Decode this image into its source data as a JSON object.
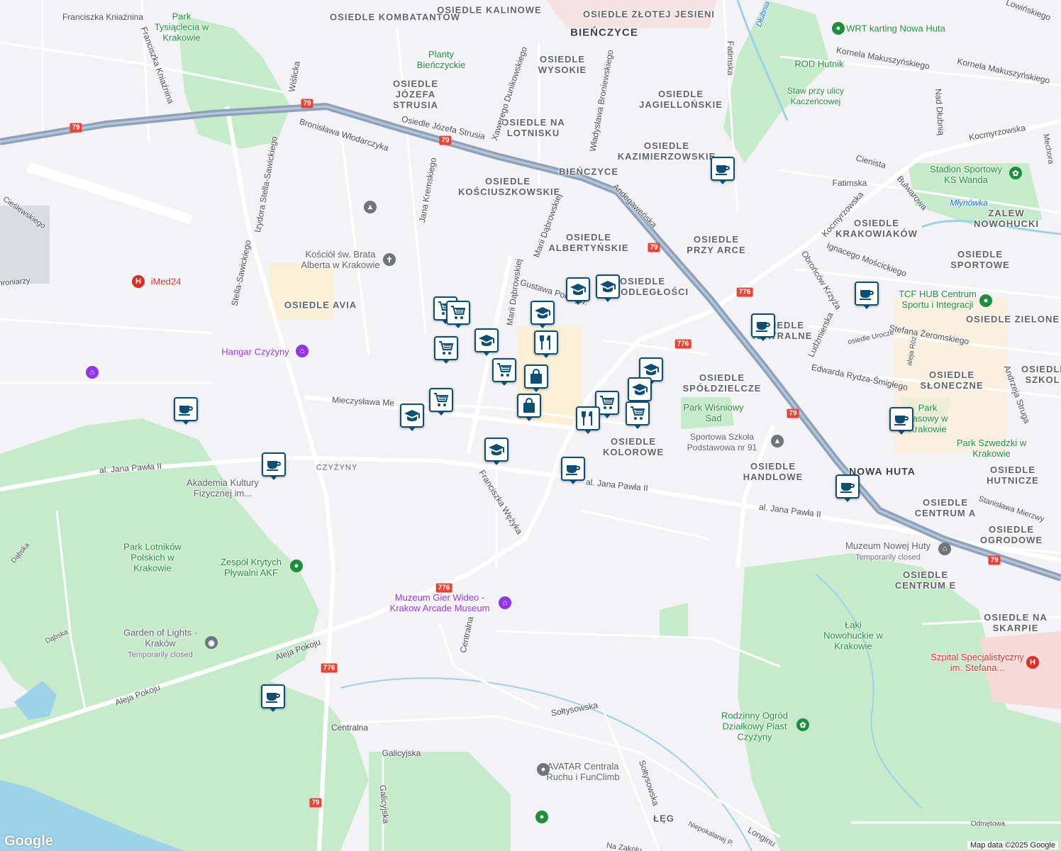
{
  "map": {
    "districts": [
      [
        "OSIEDLE KOMBATANTÓW",
        "osiedle-kombatantow"
      ],
      [
        "OSIEDLE KALINOWE",
        "osiedle-kalinowe"
      ],
      [
        "OSIEDLE ZŁOTEJ JESIENI",
        "osiedle-zlotej-jesieni"
      ],
      [
        "BIEŃCZYCE",
        "bienczyce"
      ],
      [
        "OSIEDLE WYSOKIE",
        "osiedle-wysokie"
      ],
      [
        "OSIEDLE JÓZEFA STRUSIA",
        "osiedle-jozefa-strusia"
      ],
      [
        "OSIEDLE NA LOTNISKU",
        "osiedle-na-lotnisku"
      ],
      [
        "OSIEDLE JAGIELLOŃSKIE",
        "osiedle-jagiellonskie"
      ],
      [
        "OSIEDLE KAZIMIERZOWSKIE",
        "osiedle-kazimierzowskie"
      ],
      [
        "BIEŃCZYCE",
        "bienczyce-2"
      ],
      [
        "OSIEDLE KOŚCIUSZKOWSKIE",
        "osiedle-kosciuszkowskie"
      ],
      [
        "OSIEDLE ALBERTYŃSKIE",
        "osiedle-albertynskie"
      ],
      [
        "OSIEDLE PRZY ARCE",
        "osiedle-przy-arce"
      ],
      [
        "OSIEDLE AVIA",
        "osiedle-avia"
      ],
      [
        "OSIEDLE KRAKOWIAKÓW",
        "osiedle-krakowiakow"
      ],
      [
        "OSIEDLE SPORTOWE",
        "osiedle-sportowe"
      ],
      [
        "OSIEDLE ZIELONE",
        "osiedle-zielone"
      ],
      [
        "OSIEDLE SPÓŁDZIELCZE",
        "osiedle-spoldzielcze"
      ],
      [
        "OSIEDLE SŁONECZNE",
        "osiedle-sloneczne"
      ],
      [
        "OSIEDLE KOLOROWE",
        "osiedle-kolorowe"
      ],
      [
        "OSIEDLE HANDLOWE",
        "osiedle-handlowe"
      ],
      [
        "NOWA HUTA",
        "nowa-huta"
      ],
      [
        "OSIEDLE HUTNICZE",
        "osiedle-hutnicze"
      ],
      [
        "OSIEDLE CENTRUM A",
        "osiedle-centrum-a"
      ],
      [
        "OSIEDLE OGRODOWE",
        "osiedle-ogrodowe"
      ],
      [
        "OSIEDLE CENTRUM E",
        "osiedle-centrum-e"
      ],
      [
        "OSIEDLE NA SKARPIE",
        "osiedle-na-skarpie"
      ],
      [
        "CZYŻYNY",
        "czyzyny"
      ],
      [
        "ŁĘG",
        "leg"
      ],
      [
        "ZALEW NOWOHUCKI",
        "zalew-nowohucki"
      ],
      [
        "OSIEDLE SZKOL",
        "osiedle-szkol"
      ],
      [
        "OSIEDLE TEATRALNE",
        "osiedle-teatralne"
      ],
      [
        "OSIEDLE NIEPODLEGŁOŚCI",
        "osiedle-niepodleglosci"
      ]
    ],
    "roads": [
      "Franciszka Kniaźnina",
      "Franciszka Kniaźnina",
      "Wiślicka",
      "Izydora Stella-Sawickiego",
      "Bronisława Włodarczyka",
      "Osiedle Józefa Strusia",
      "Xawerego Dunikowskiego",
      "Władysława Broniewskiego",
      "Fatimska",
      "Kornela Makuszyńskiego",
      "Kornela Makuszyńskiego",
      "Nad Dłubnią",
      "Kocmyrzowska",
      "Kocmyrzowska",
      "Cienista",
      "Fatimska",
      "Bulwarowa",
      "Młynówka",
      "Andegaweńska",
      "Marii Dąbrowskiej",
      "Marii Dąbrowskiej",
      "Jana Kremskiego",
      "Gustawa Pokrzyw.",
      "Mieczysława Me",
      "al. Jana Pawła II",
      "al. Jana Pawła II",
      "al. Jana Pawła II",
      "Franciszka Wężyka",
      "Ignacego Mościckiego",
      "Obrońców Krzyża",
      "Stefana Żeromskiego",
      "Ludźmierska",
      "osiedle Urocze",
      "aleja Róż",
      "Edwarda Rydza-Śmigłego",
      "Andrzeja Struga",
      "Stanisława Mierzwy",
      "Aleja Pokoju",
      "Aleja Pokoju",
      "Centralna",
      "Centralna",
      "Galicyjska",
      "Galicyjska",
      "Sołtysowska",
      "Sołtysowska",
      "Niepokalanej P.",
      "Longinu",
      "Odmętowa",
      "Dąbska",
      "Dąbska",
      "Cieślewskiego",
      "Lowińskiego",
      "Mechora",
      "Dłubnia",
      "Stella-Sawickiego",
      "hroniarzy",
      "Na Zakolu"
    ],
    "shields": [
      "79",
      "79",
      "79",
      "79",
      "79",
      "79",
      "776",
      "776",
      "776",
      "776",
      "79"
    ],
    "pois": [
      {
        "text": "Park Tysiąclecia w Krakowie",
        "type": "green-text"
      },
      {
        "text": "Planty Bieńczyckie",
        "type": "green-text"
      },
      {
        "text": "WRT karting Nowa Huta",
        "type": "green"
      },
      {
        "text": "ROD Hutnik",
        "type": "green-text"
      },
      {
        "text": "Staw przy ulicy Kaczeńcowej",
        "type": "green-text"
      },
      {
        "text": "Stadion Sportowy KS Wanda",
        "type": "green"
      },
      {
        "text": "Kościół św. Brata Alberta w Krakowie",
        "type": "gray"
      },
      {
        "text": "iMed24",
        "type": "red"
      },
      {
        "text": "Hangar Czyżyny",
        "type": "purple"
      },
      {
        "text": "TCF HUB Centrum Sportu i Integracji",
        "type": "green"
      },
      {
        "text": "Park Wiśniowy Sad",
        "type": "green-text"
      },
      {
        "text": "Sportowa Szkoła Podstawowa nr 91",
        "type": "gray"
      },
      {
        "text": "Park Szwedzki w Krakowie",
        "type": "green-text"
      },
      {
        "text": "Park Lasowy w Krakowie",
        "type": "green-text"
      },
      {
        "text": "Akademia Kultury Fizycznej im...",
        "type": "gray"
      },
      {
        "text": "Park Lotników Polskich w Krakowie",
        "type": "green-text"
      },
      {
        "text": "Zespół Krytych Pływalni AKF",
        "type": "green"
      },
      {
        "text": "Muzeum Nowej Huty",
        "type": "gray",
        "note": "Temporarily closed"
      },
      {
        "text": "Muzeum Gier Wideo - Krakow Arcade Museum",
        "type": "purple"
      },
      {
        "text": "Garden of Lights - Kraków",
        "type": "gray",
        "note": "Temporarily closed"
      },
      {
        "text": "Łąki Nowohuckie w Krakowie",
        "type": "green-text"
      },
      {
        "text": "Szpital Specjalistyczny im. Stefana...",
        "type": "red"
      },
      {
        "text": "Rodzinny Ogród Działkowy Piast Czyżyny",
        "type": "green"
      },
      {
        "text": "AVATAR Centrala Ruchu i FunClimb",
        "type": "gray"
      }
    ],
    "markers": [
      {
        "type": "cafe"
      },
      {
        "type": "cafe"
      },
      {
        "type": "cafe"
      },
      {
        "type": "cafe"
      },
      {
        "type": "cafe"
      },
      {
        "type": "cafe"
      },
      {
        "type": "cafe"
      },
      {
        "type": "cafe"
      },
      {
        "type": "cafe"
      },
      {
        "type": "school"
      },
      {
        "type": "school"
      },
      {
        "type": "school"
      },
      {
        "type": "school"
      },
      {
        "type": "school"
      },
      {
        "type": "school"
      },
      {
        "type": "school"
      },
      {
        "type": "school"
      },
      {
        "type": "shop"
      },
      {
        "type": "shop"
      },
      {
        "type": "shop"
      },
      {
        "type": "shop"
      },
      {
        "type": "shop"
      },
      {
        "type": "shop"
      },
      {
        "type": "shop"
      },
      {
        "type": "restaurant"
      },
      {
        "type": "restaurant"
      },
      {
        "type": "bag"
      },
      {
        "type": "bag"
      }
    ],
    "colors": {
      "water": "#9cd3e8",
      "park": "#c6ebcb",
      "road": "#ffffff",
      "highway": "#8da3bd",
      "marker": "#0b4f75",
      "background": "#f3f2f4"
    },
    "attribution": "Map data ©2025 Google",
    "logo": "Google"
  }
}
